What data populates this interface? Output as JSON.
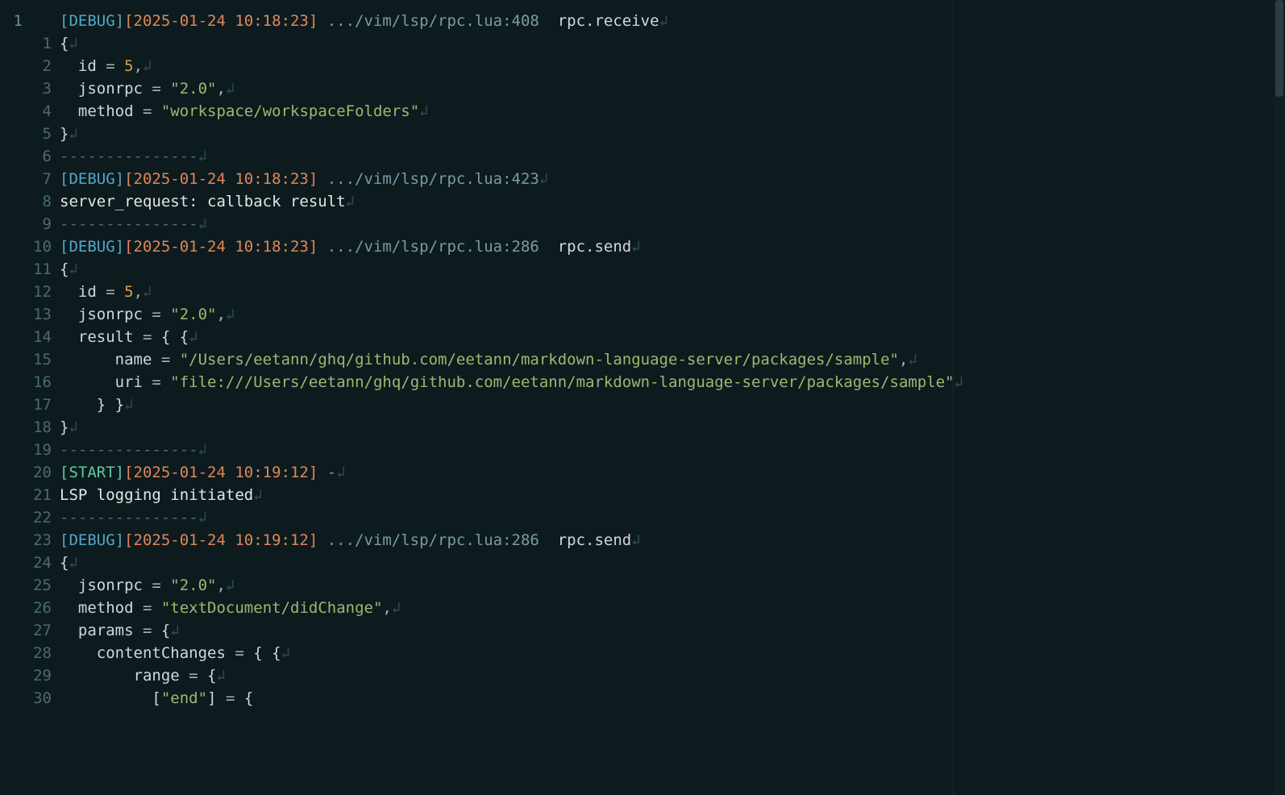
{
  "gutter": {
    "main": [
      "1",
      "",
      "",
      "",
      "",
      "",
      "",
      "",
      "",
      "",
      "",
      "",
      "",
      "",
      "",
      "",
      "",
      "",
      "",
      "",
      "",
      "",
      "",
      "",
      "",
      "",
      "",
      "",
      "",
      "",
      ""
    ],
    "sub": [
      "",
      "1",
      "2",
      "3",
      "4",
      "5",
      "6",
      "7",
      "8",
      "9",
      "10",
      "11",
      "12",
      "13",
      "14",
      "15",
      "16",
      "17",
      "18",
      "19",
      "20",
      "21",
      "22",
      "23",
      "24",
      "25",
      "26",
      "27",
      "28",
      "29",
      "30"
    ]
  },
  "lines": [
    {
      "t": "log",
      "tag": "[DEBUG]",
      "tagClass": "tag-debug",
      "ts": "[2025-01-24 10:18:23]",
      "path": " .../vim/lsp/rpc.lua:408",
      "fn": "  rpc.receive"
    },
    {
      "t": "plain",
      "segs": [
        {
          "c": "brace",
          "v": "{"
        }
      ]
    },
    {
      "t": "plain",
      "segs": [
        {
          "c": "plain",
          "v": "  "
        },
        {
          "c": "key",
          "v": "id"
        },
        {
          "c": "eq",
          "v": " = "
        },
        {
          "c": "num",
          "v": "5"
        },
        {
          "c": "punct",
          "v": ","
        }
      ]
    },
    {
      "t": "plain",
      "segs": [
        {
          "c": "plain",
          "v": "  "
        },
        {
          "c": "key",
          "v": "jsonrpc"
        },
        {
          "c": "eq",
          "v": " = "
        },
        {
          "c": "str",
          "v": "\"2.0\""
        },
        {
          "c": "punct",
          "v": ","
        }
      ]
    },
    {
      "t": "plain",
      "segs": [
        {
          "c": "plain",
          "v": "  "
        },
        {
          "c": "key",
          "v": "method"
        },
        {
          "c": "eq",
          "v": " = "
        },
        {
          "c": "str",
          "v": "\"workspace/workspaceFolders\""
        }
      ]
    },
    {
      "t": "plain",
      "segs": [
        {
          "c": "brace",
          "v": "}"
        }
      ]
    },
    {
      "t": "sep",
      "v": "---------------"
    },
    {
      "t": "log",
      "tag": "[DEBUG]",
      "tagClass": "tag-debug",
      "ts": "[2025-01-24 10:18:23]",
      "path": " .../vim/lsp/rpc.lua:423",
      "fn": ""
    },
    {
      "t": "plain",
      "segs": [
        {
          "c": "plain",
          "v": "server_request: callback result"
        }
      ]
    },
    {
      "t": "sep",
      "v": "---------------"
    },
    {
      "t": "log",
      "tag": "[DEBUG]",
      "tagClass": "tag-debug",
      "ts": "[2025-01-24 10:18:23]",
      "path": " .../vim/lsp/rpc.lua:286",
      "fn": "  rpc.send"
    },
    {
      "t": "plain",
      "segs": [
        {
          "c": "brace",
          "v": "{"
        }
      ]
    },
    {
      "t": "plain",
      "segs": [
        {
          "c": "plain",
          "v": "  "
        },
        {
          "c": "key",
          "v": "id"
        },
        {
          "c": "eq",
          "v": " = "
        },
        {
          "c": "num",
          "v": "5"
        },
        {
          "c": "punct",
          "v": ","
        }
      ]
    },
    {
      "t": "plain",
      "segs": [
        {
          "c": "plain",
          "v": "  "
        },
        {
          "c": "key",
          "v": "jsonrpc"
        },
        {
          "c": "eq",
          "v": " = "
        },
        {
          "c": "str",
          "v": "\"2.0\""
        },
        {
          "c": "punct",
          "v": ","
        }
      ]
    },
    {
      "t": "plain",
      "segs": [
        {
          "c": "plain",
          "v": "  "
        },
        {
          "c": "key",
          "v": "result"
        },
        {
          "c": "eq",
          "v": " = "
        },
        {
          "c": "brace",
          "v": "{ {"
        }
      ]
    },
    {
      "t": "plain",
      "segs": [
        {
          "c": "plain",
          "v": "      "
        },
        {
          "c": "key",
          "v": "name"
        },
        {
          "c": "eq",
          "v": " = "
        },
        {
          "c": "str",
          "v": "\"/Users/eetann/ghq/github.com/eetann/markdown-language-server/packages/sample\""
        },
        {
          "c": "punct",
          "v": ","
        }
      ]
    },
    {
      "t": "plain",
      "segs": [
        {
          "c": "plain",
          "v": "      "
        },
        {
          "c": "key",
          "v": "uri"
        },
        {
          "c": "eq",
          "v": " = "
        },
        {
          "c": "str",
          "v": "\"file:///Users/eetann/ghq/github.com/eetann/markdown-language-server/packages/sample\""
        }
      ]
    },
    {
      "t": "plain",
      "segs": [
        {
          "c": "plain",
          "v": "    "
        },
        {
          "c": "brace",
          "v": "} }"
        }
      ]
    },
    {
      "t": "plain",
      "segs": [
        {
          "c": "brace",
          "v": "}"
        }
      ]
    },
    {
      "t": "sep",
      "v": "---------------"
    },
    {
      "t": "log",
      "tag": "[START]",
      "tagClass": "tag-start",
      "ts": "[2025-01-24 10:19:12]",
      "path": " -",
      "fn": ""
    },
    {
      "t": "plain",
      "segs": [
        {
          "c": "plain",
          "v": "LSP logging initiated"
        }
      ]
    },
    {
      "t": "sep",
      "v": "---------------"
    },
    {
      "t": "log",
      "tag": "[DEBUG]",
      "tagClass": "tag-debug",
      "ts": "[2025-01-24 10:19:12]",
      "path": " .../vim/lsp/rpc.lua:286",
      "fn": "  rpc.send"
    },
    {
      "t": "plain",
      "segs": [
        {
          "c": "brace",
          "v": "{"
        }
      ]
    },
    {
      "t": "plain",
      "segs": [
        {
          "c": "plain",
          "v": "  "
        },
        {
          "c": "key",
          "v": "jsonrpc"
        },
        {
          "c": "eq",
          "v": " = "
        },
        {
          "c": "str",
          "v": "\"2.0\""
        },
        {
          "c": "punct",
          "v": ","
        }
      ]
    },
    {
      "t": "plain",
      "segs": [
        {
          "c": "plain",
          "v": "  "
        },
        {
          "c": "key",
          "v": "method"
        },
        {
          "c": "eq",
          "v": " = "
        },
        {
          "c": "str",
          "v": "\"textDocument/didChange\""
        },
        {
          "c": "punct",
          "v": ","
        }
      ]
    },
    {
      "t": "plain",
      "segs": [
        {
          "c": "plain",
          "v": "  "
        },
        {
          "c": "key",
          "v": "params"
        },
        {
          "c": "eq",
          "v": " = "
        },
        {
          "c": "brace",
          "v": "{"
        }
      ]
    },
    {
      "t": "plain",
      "segs": [
        {
          "c": "plain",
          "v": "    "
        },
        {
          "c": "key",
          "v": "contentChanges"
        },
        {
          "c": "eq",
          "v": " = "
        },
        {
          "c": "brace",
          "v": "{ {"
        }
      ]
    },
    {
      "t": "plain",
      "segs": [
        {
          "c": "plain",
          "v": "        "
        },
        {
          "c": "key",
          "v": "range"
        },
        {
          "c": "eq",
          "v": " = "
        },
        {
          "c": "brace",
          "v": "{"
        }
      ]
    },
    {
      "t": "plain",
      "segs": [
        {
          "c": "plain",
          "v": "          "
        },
        {
          "c": "brace",
          "v": "["
        },
        {
          "c": "str",
          "v": "\"end\""
        },
        {
          "c": "brace",
          "v": "]"
        },
        {
          "c": "eq",
          "v": " = "
        },
        {
          "c": "brace",
          "v": "{"
        }
      ]
    }
  ],
  "eolGlyph": "↲"
}
